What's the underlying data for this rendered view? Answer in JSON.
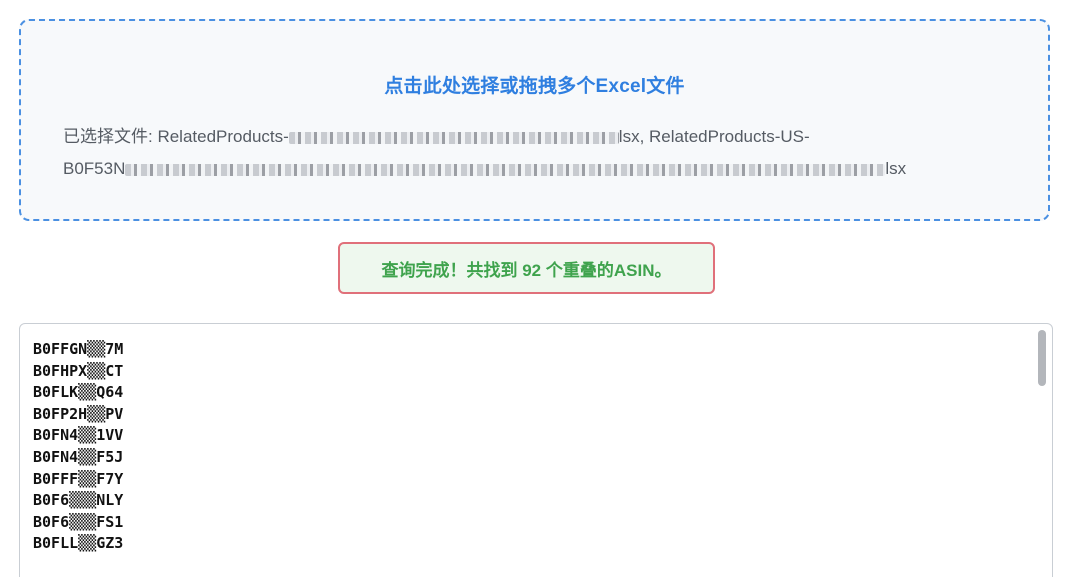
{
  "dropzone": {
    "title": "点击此处选择或拖拽多个Excel文件",
    "files_label": "已选择文件: ",
    "file1_prefix": "RelatedProducts-",
    "file1_suffix": "lsx,",
    "file2_prefix": "RelatedProducts-US-",
    "file2_line2_prefix": "B0F53N",
    "file2_suffix": "lsx"
  },
  "status": {
    "message": "查询完成！共找到 92 个重叠的ASIN。"
  },
  "results": {
    "asins": [
      "B0FFGN▒▒7M",
      "B0FHPX▒▒CT",
      "B0FLK▒▒Q64",
      "B0FP2H▒▒PV",
      "B0FN4▒▒1VV",
      "B0FN4▒▒F5J",
      "B0FFF▒▒F7Y",
      "B0F6▒▒▒NLY",
      "B0F6▒▒▒FS1",
      "B0FLL▒▒GZ3"
    ]
  }
}
